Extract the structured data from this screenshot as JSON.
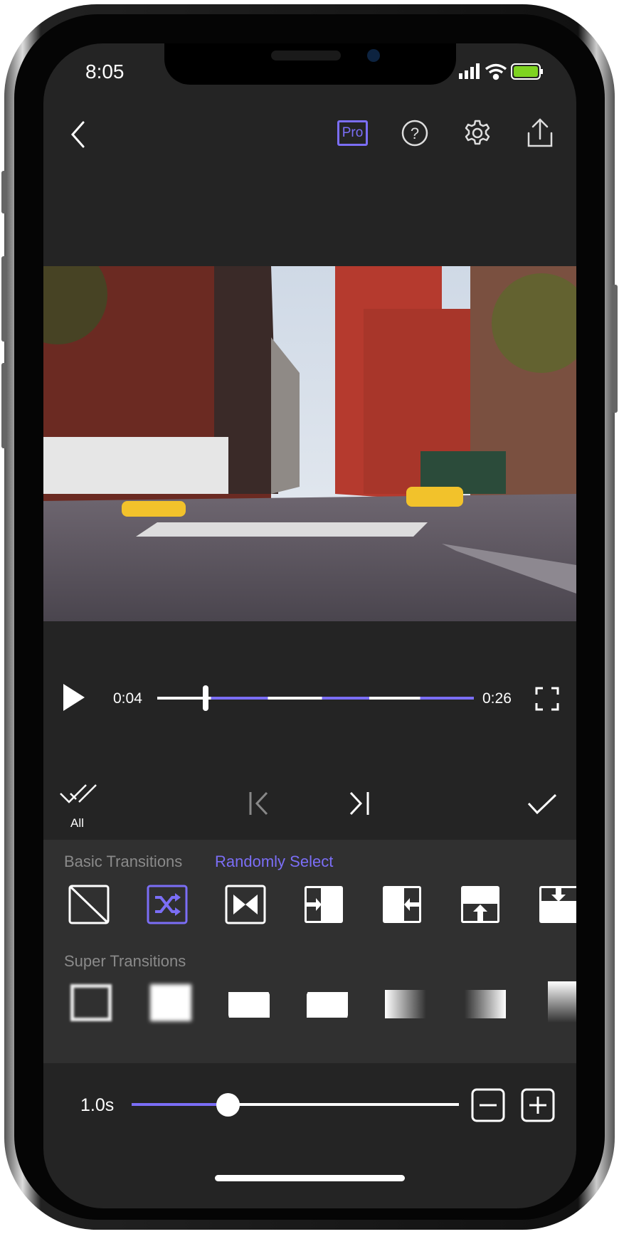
{
  "status": {
    "time": "8:05",
    "battery_color": "#7ed321"
  },
  "toolbar": {
    "back": "chevron-left-icon",
    "pro": "Pro",
    "help": "help-icon",
    "settings": "gear-icon",
    "share": "share-icon"
  },
  "player": {
    "current": "0:04",
    "total": "0:26",
    "progress": 0.154,
    "accent": "#7b6ef6"
  },
  "actions": {
    "all": "All"
  },
  "basic": {
    "title": "Basic Transitions",
    "random": "Randomly Select",
    "items": [
      "none",
      "random",
      "cross",
      "push-right",
      "push-left",
      "push-up",
      "push-down"
    ],
    "selected": "random"
  },
  "super": {
    "title": "Super Transitions",
    "items": [
      "blur-frame",
      "blur-fill",
      "wave-left",
      "wave-right",
      "fade-right",
      "fade-left",
      "fade-down"
    ]
  },
  "duration": {
    "value": "1.0s",
    "level": 0.3
  }
}
